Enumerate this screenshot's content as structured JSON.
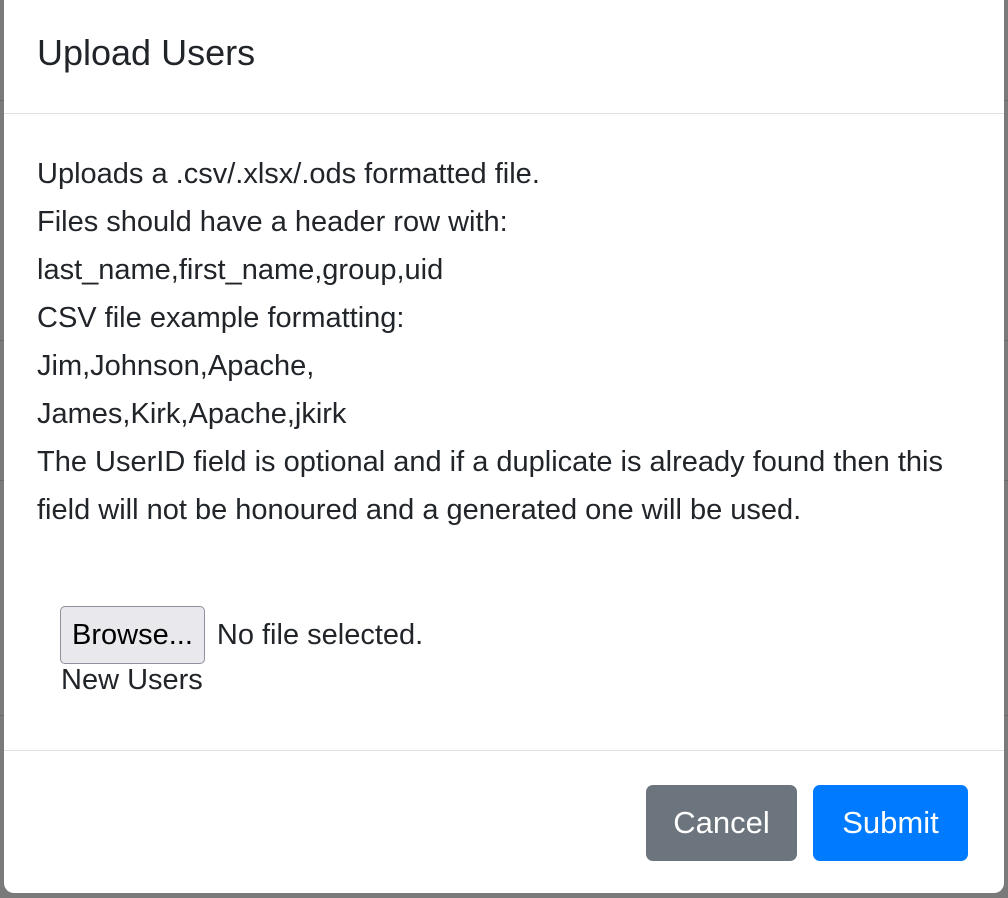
{
  "modal": {
    "title": "Upload Users",
    "instructions": [
      "Uploads a .csv/.xlsx/.ods formatted file.",
      "Files should have a header row with:",
      "last_name,first_name,group,uid",
      "CSV file example formatting:",
      "Jim,Johnson,Apache,",
      "James,Kirk,Apache,jkirk"
    ],
    "note": "The UserID field is optional and if a duplicate is already found then this field will not be honoured and a generated one will be used.",
    "file_input": {
      "browse_label": "Browse...",
      "status": "No file selected.",
      "label": "New Users"
    },
    "footer": {
      "cancel_label": "Cancel",
      "submit_label": "Submit"
    }
  },
  "colors": {
    "secondary": "#6c757d",
    "primary": "#007bff",
    "divider": "#dee2e6",
    "text": "#212529"
  }
}
